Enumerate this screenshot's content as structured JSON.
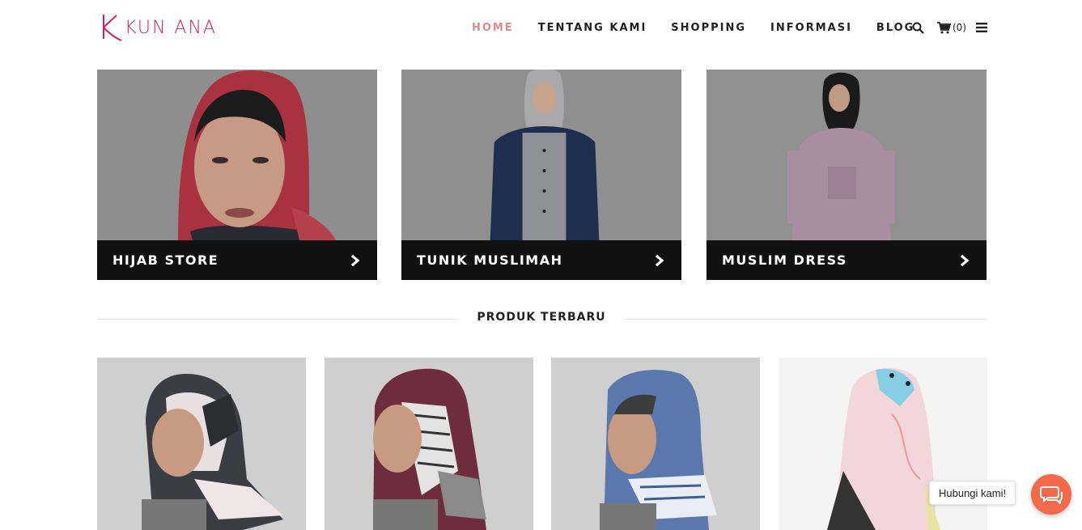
{
  "brand": {
    "name": "KUN ANA",
    "color": "#d61f69"
  },
  "nav": {
    "items": [
      {
        "label": "HOME",
        "active": true
      },
      {
        "label": "TENTANG KAMI",
        "active": false
      },
      {
        "label": "SHOPPING",
        "active": false
      },
      {
        "label": "INFORMASI",
        "active": false
      },
      {
        "label": "BLOG",
        "active": false
      }
    ],
    "cart_count": "(0)",
    "icons": [
      "search-icon",
      "cart-icon",
      "menu-icon"
    ]
  },
  "categories": [
    {
      "label": "HIJAB STORE",
      "icon": "chevron-right-icon"
    },
    {
      "label": "TUNIK MUSLIMAH",
      "icon": "chevron-right-icon"
    },
    {
      "label": "MUSLIM DRESS",
      "icon": "chevron-right-icon"
    }
  ],
  "section": {
    "title": "PRODUK TERBARU"
  },
  "products": [
    {
      "image": "black-white-pattern-hijab"
    },
    {
      "image": "maroon-pattern-hijab"
    },
    {
      "image": "blue-hijab"
    },
    {
      "image": "pink-floral-hijab"
    }
  ],
  "chat": {
    "label": "Hubungi kami!",
    "icon": "chat-icon",
    "color": "#f26a4a"
  },
  "colors": {
    "active_nav": "#e08a8f",
    "dark_bar": "#111111"
  }
}
